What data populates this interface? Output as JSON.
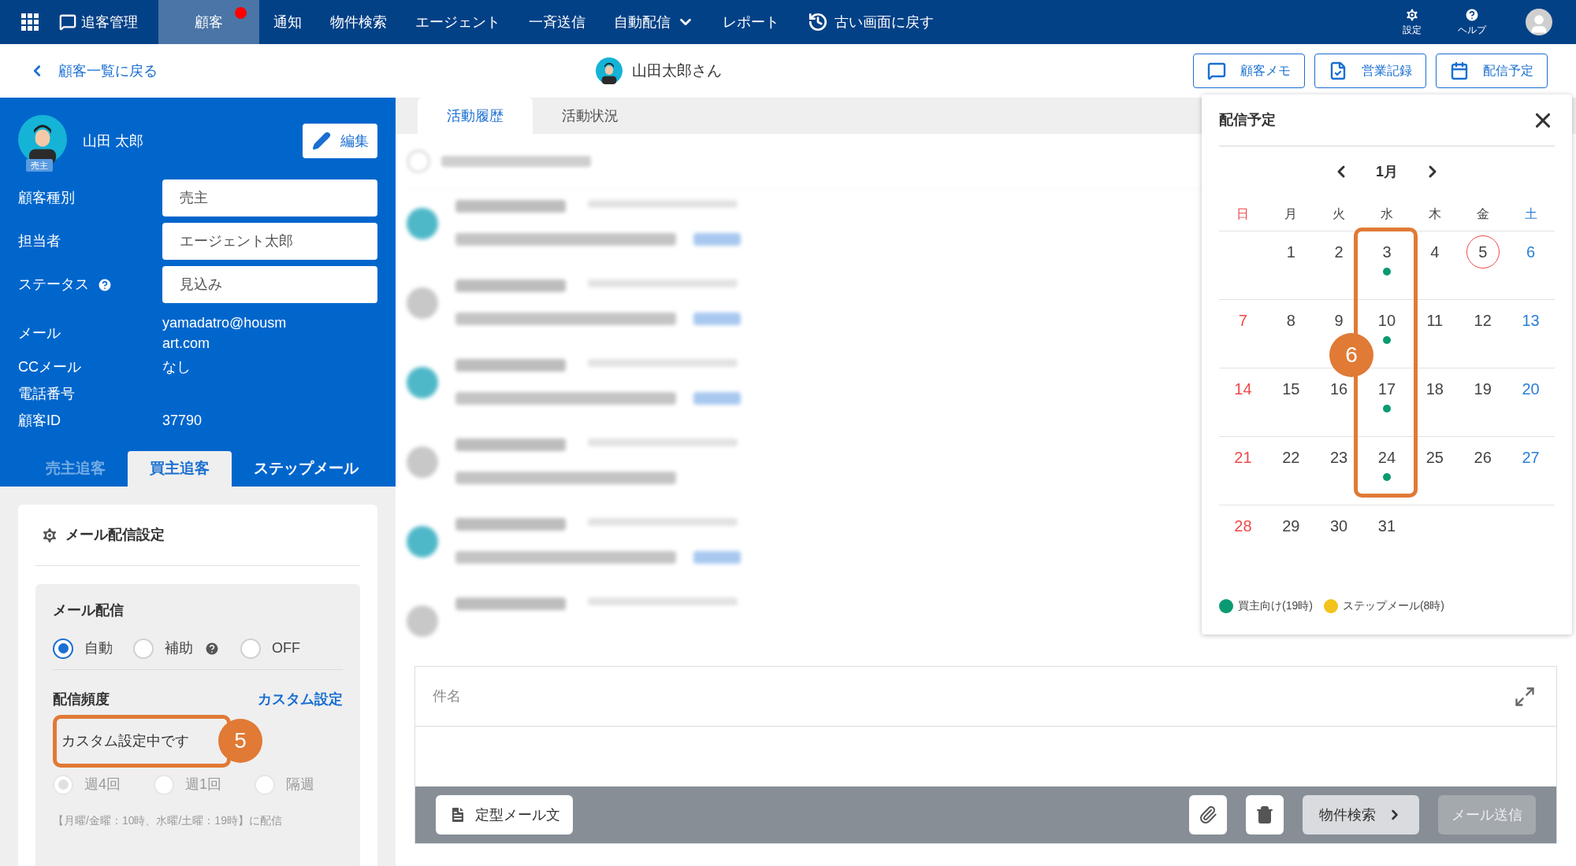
{
  "nav": {
    "app": "追客管理",
    "items": [
      {
        "label": "顧客",
        "selected": true,
        "alert": true,
        "kind": "plain"
      },
      {
        "label": "通知",
        "selected": false,
        "alert": false,
        "kind": "plain"
      },
      {
        "label": "物件検索",
        "selected": false,
        "alert": false,
        "kind": "plain"
      },
      {
        "label": "エージェント",
        "selected": false,
        "alert": false,
        "kind": "plain"
      },
      {
        "label": "一斉送信",
        "selected": false,
        "alert": false,
        "kind": "plain"
      },
      {
        "label": "自動配信",
        "selected": false,
        "alert": false,
        "kind": "dropdown"
      },
      {
        "label": "レポート",
        "selected": false,
        "alert": false,
        "kind": "plain"
      },
      {
        "label": "古い画面に戻す",
        "selected": false,
        "alert": false,
        "kind": "restore"
      }
    ],
    "settings": "設定",
    "help": "ヘルプ"
  },
  "header": {
    "back": "顧客一覧に戻る",
    "customer": "山田太郎さん",
    "buttons": [
      {
        "label": "顧客メモ",
        "kind": "memo"
      },
      {
        "label": "営業記録",
        "kind": "record"
      },
      {
        "label": "配信予定",
        "kind": "calendar"
      }
    ]
  },
  "profile": {
    "name": "山田 太郎",
    "role": "売主",
    "edit": "編集",
    "fields": [
      {
        "label": "顧客種別",
        "value": "売主"
      },
      {
        "label": "担当者",
        "value": "エージェント太郎"
      },
      {
        "label": "ステータス",
        "value": "見込み",
        "help": true
      }
    ],
    "info": [
      {
        "label": "メール",
        "value": "yamadatro@housmart.com"
      },
      {
        "label": "CCメール",
        "value": "なし"
      },
      {
        "label": "電話番号"
      },
      {
        "label": "顧客ID",
        "value": "37790"
      }
    ],
    "tabs": [
      {
        "label": "売主追客",
        "selected": false,
        "disabled": true
      },
      {
        "label": "買主追客",
        "selected": true,
        "disabled": false
      },
      {
        "label": "ステップメール",
        "selected": false,
        "disabled": false
      }
    ]
  },
  "mail_settings": {
    "title": "メール配信設定",
    "delivery_label": "メール配信",
    "delivery": [
      {
        "label": "自動",
        "selected": true
      },
      {
        "label": "補助",
        "selected": false,
        "help": true
      },
      {
        "label": "OFF",
        "selected": false
      }
    ],
    "frequency_label": "配信頻度",
    "custom_link": "カスタム設定",
    "custom_note": "カスタム設定中です",
    "note_badge": "5",
    "frequency": [
      {
        "label": "週4回",
        "selected": true,
        "disabled": true
      },
      {
        "label": "週1回",
        "selected": false,
        "disabled": true
      },
      {
        "label": "隔週",
        "selected": false,
        "disabled": true
      }
    ],
    "schedule": "【月曜/金曜：10時、水曜/土曜：19時】に配信"
  },
  "activity": {
    "tabs": [
      {
        "label": "活動履歴",
        "selected": true
      },
      {
        "label": "活動状況",
        "selected": false
      }
    ],
    "feed": [
      {
        "kind": "checkbox",
        "checked": false
      },
      {
        "kind": "entry",
        "color": "#4fb8c8",
        "link": true
      },
      {
        "kind": "entry",
        "color": "#c8c8c8",
        "link": true
      },
      {
        "kind": "entry",
        "color": "#4fb8c8",
        "link": true
      },
      {
        "kind": "entry",
        "color": "#c8c8c8"
      },
      {
        "kind": "entry",
        "color": "#4fb8c8",
        "link": true
      },
      {
        "kind": "partial",
        "color": "#c8c8c8"
      }
    ]
  },
  "composer": {
    "placeholder": "件名",
    "template": "定型メール文",
    "property_search": "物件検索",
    "send": "メール送信",
    "send_disabled": true
  },
  "schedule_popup": {
    "title": "配信予定",
    "month": "1月",
    "weekdays": [
      "日",
      "月",
      "火",
      "水",
      "木",
      "金",
      "土"
    ],
    "weeks": [
      [
        {
          "kind": "blank"
        },
        {
          "kind": "day",
          "day": "1"
        },
        {
          "kind": "day",
          "day": "2"
        },
        {
          "kind": "day",
          "day": "3",
          "color": "#0a9a72"
        },
        {
          "kind": "day",
          "day": "4"
        },
        {
          "kind": "day",
          "day": "5",
          "today": true
        },
        {
          "kind": "day",
          "day": "6"
        }
      ],
      [
        {
          "kind": "day",
          "day": "7"
        },
        {
          "kind": "day",
          "day": "8"
        },
        {
          "kind": "day",
          "day": "9"
        },
        {
          "kind": "day",
          "day": "10",
          "color": "#0a9a72"
        },
        {
          "kind": "day",
          "day": "11"
        },
        {
          "kind": "day",
          "day": "12"
        },
        {
          "kind": "day",
          "day": "13"
        }
      ],
      [
        {
          "kind": "day",
          "day": "14"
        },
        {
          "kind": "day",
          "day": "15"
        },
        {
          "kind": "day",
          "day": "16"
        },
        {
          "kind": "day",
          "day": "17",
          "color": "#0a9a72"
        },
        {
          "kind": "day",
          "day": "18"
        },
        {
          "kind": "day",
          "day": "19"
        },
        {
          "kind": "day",
          "day": "20"
        }
      ],
      [
        {
          "kind": "day",
          "day": "21"
        },
        {
          "kind": "day",
          "day": "22"
        },
        {
          "kind": "day",
          "day": "23"
        },
        {
          "kind": "day",
          "day": "24",
          "color": "#0a9a72"
        },
        {
          "kind": "day",
          "day": "25"
        },
        {
          "kind": "day",
          "day": "26"
        },
        {
          "kind": "day",
          "day": "27"
        }
      ],
      [
        {
          "kind": "day",
          "day": "28"
        },
        {
          "kind": "day",
          "day": "29"
        },
        {
          "kind": "day",
          "day": "30"
        },
        {
          "kind": "day",
          "day": "31"
        },
        {
          "kind": "blank"
        },
        {
          "kind": "blank"
        },
        {
          "kind": "blank"
        }
      ]
    ],
    "highlight_badge": "6",
    "legend": [
      {
        "label": "買主向け(19時)",
        "color": "#0a9a72"
      },
      {
        "label": "ステップメール(8時)",
        "color": "#f2c31b"
      }
    ]
  }
}
